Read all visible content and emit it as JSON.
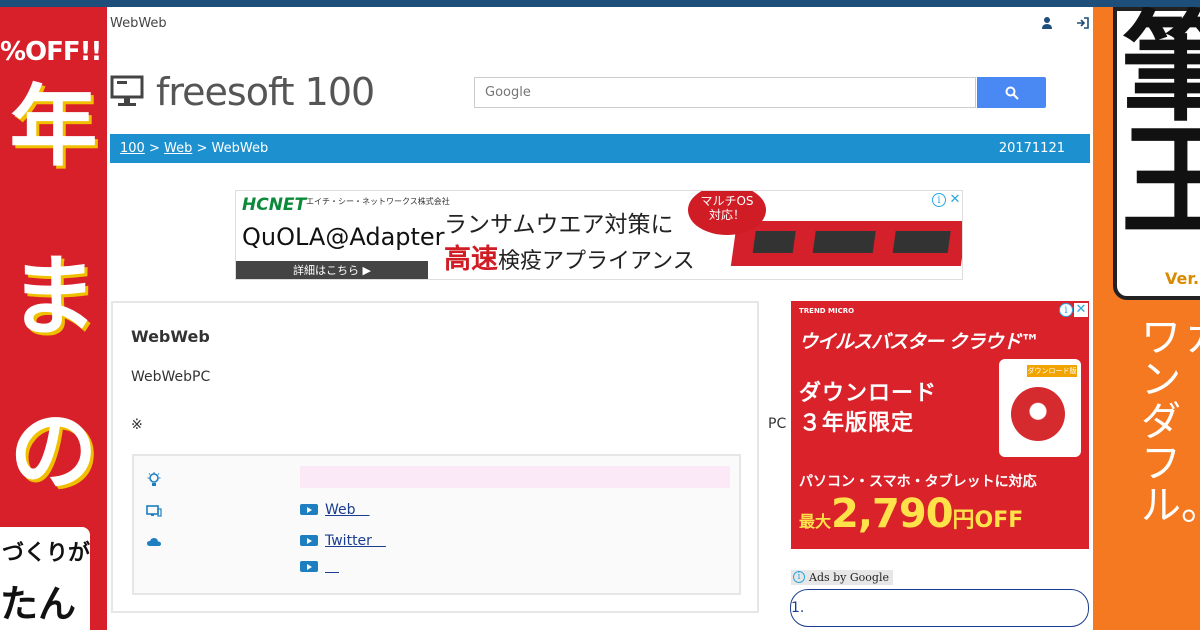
{
  "colors": {
    "topbar": "#1d4f7a",
    "breadcrumb_bg": "#1d91cf",
    "search_button": "#4a89f3",
    "link": "#1a3d8f",
    "ad_red": "#d9222a",
    "side_orange": "#f47920"
  },
  "header": {
    "site_label": "WebWeb",
    "logo_text": "freesoft 100",
    "user_icon": "user-icon",
    "login_icon": "login-icon"
  },
  "search": {
    "placeholder": "Google",
    "button_icon": "search-icon"
  },
  "breadcrumb": {
    "items": [
      "100",
      "Web"
    ],
    "separator": ">",
    "current": "WebWeb",
    "date": "20171121"
  },
  "banner_ad": {
    "brand": "HCNET",
    "brand_jp": "エイチ・シー・ネットワークス株式会社",
    "product": "QuOLA@Adapter",
    "detail": "詳細はこちら ▶",
    "headline": "ランサムウエア対策に",
    "sub_red": "高速",
    "sub_rest": "検疫アプライアンス",
    "badge": "マルチOS\n対応！"
  },
  "content": {
    "title": "WebWeb",
    "description": "WebWebPC",
    "note": "※",
    "side_text": "PC",
    "info_rows": [
      {
        "icon": "lightbulb-icon",
        "type": "highlight",
        "link": ""
      },
      {
        "icon": "monitor-icon",
        "type": "link",
        "link": "Web　"
      },
      {
        "icon": "cloud-icon",
        "type": "link",
        "link": "Twitter　"
      },
      {
        "icon": "",
        "type": "link",
        "link": "　"
      }
    ]
  },
  "right_ad": {
    "trend": "TREND MICRO",
    "product_name": "ウイルスバスター クラウド™",
    "download_line1": "ダウンロード",
    "download_line2": "３年版限定",
    "box_badge": "ダウンロード版",
    "support": "パソコン・スマホ・タブレットに対応",
    "price_prefix": "最大",
    "price_value": "2,790",
    "price_suffix": "円OFF"
  },
  "ads_by_google": {
    "label": "Ads by Google",
    "item_1": "1."
  },
  "side_left": {
    "promo": "%OFF!!",
    "kanji_1": "年",
    "kanji_2": "ま",
    "kanji_3": "の",
    "box_line_1": "づくりが",
    "box_line_2": "たん"
  },
  "side_right": {
    "version": "Ver.",
    "vertical_1": "ワンダフル。",
    "vertical_2": "カ"
  }
}
